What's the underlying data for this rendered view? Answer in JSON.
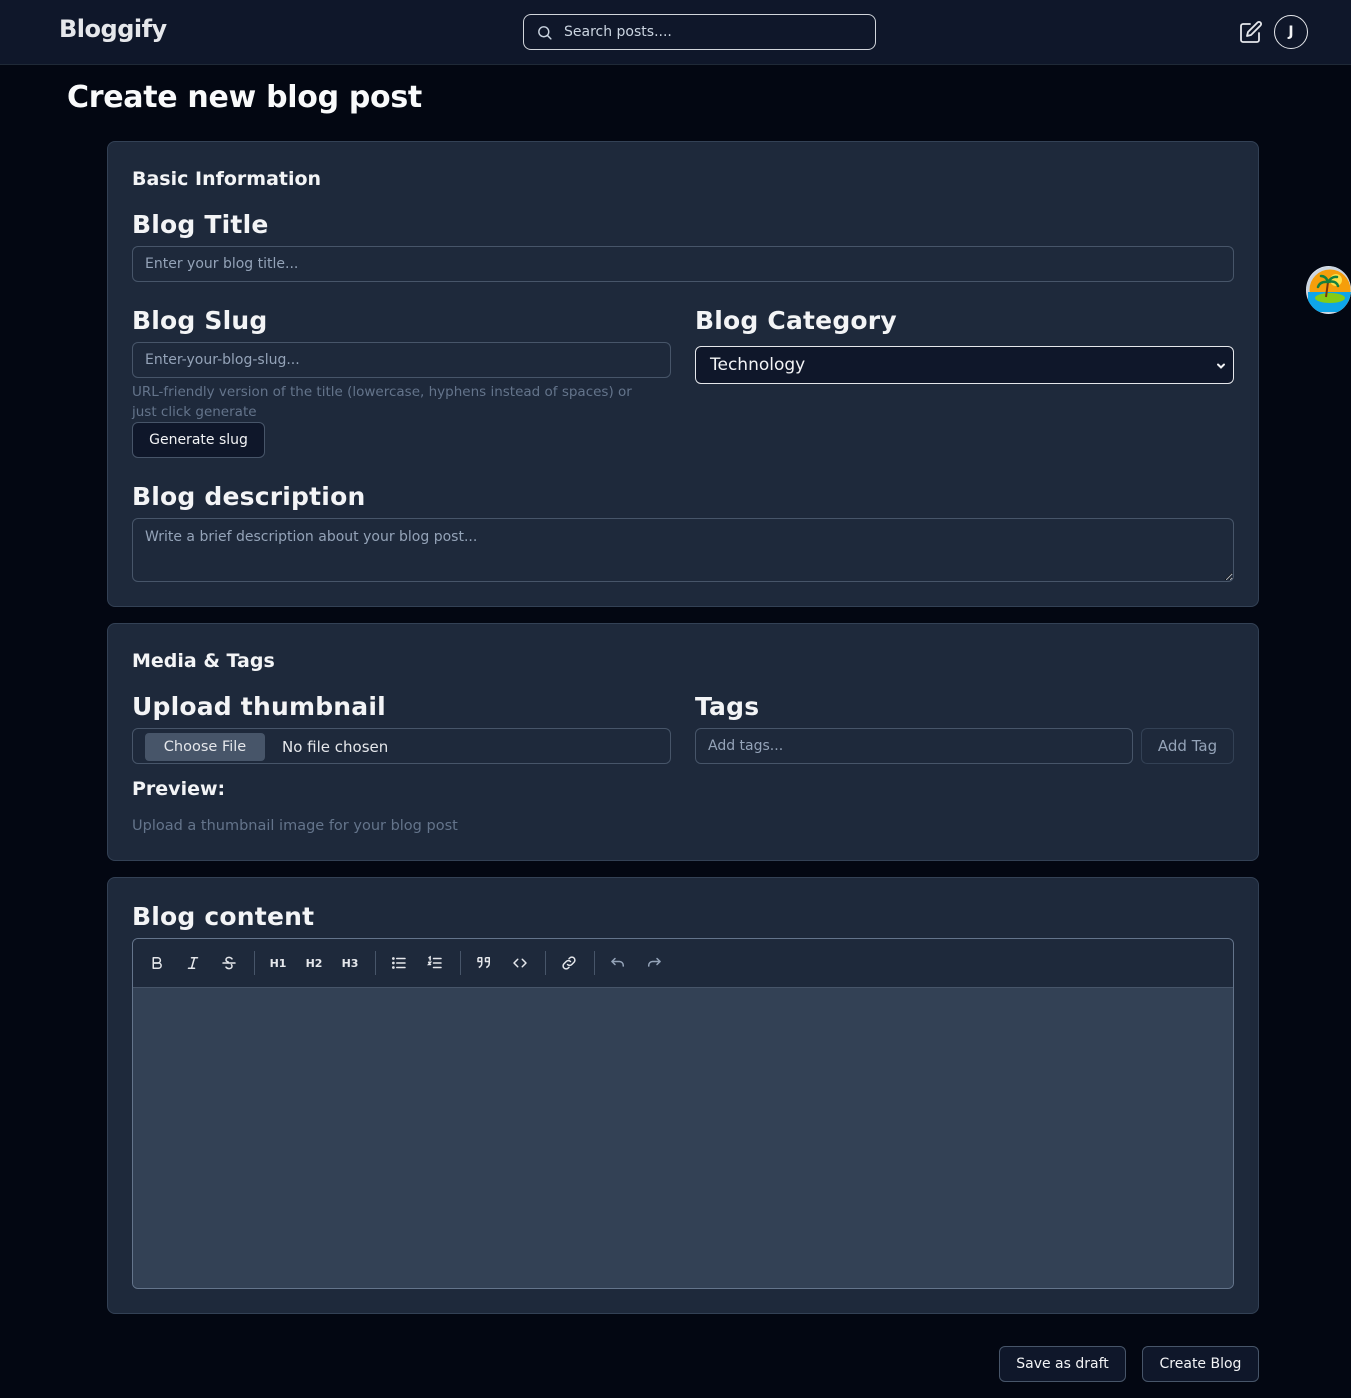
{
  "header": {
    "logo": "Bloggify",
    "search_placeholder": "Search posts....",
    "avatar_initial": "J"
  },
  "page": {
    "title": "Create new blog post"
  },
  "basic": {
    "heading": "Basic Information",
    "title_label": "Blog Title",
    "title_placeholder": "Enter your blog title...",
    "slug_label": "Blog Slug",
    "slug_placeholder": "Enter-your-blog-slug...",
    "slug_hint_line1": "URL-friendly version of the title (lowercase, hyphens instead of spaces) or",
    "slug_hint_line2": "just click generate",
    "generate_label": "Generate slug",
    "category_label": "Blog Category",
    "category_value": "Technology",
    "description_label": "Blog description",
    "description_placeholder": "Write a brief description about your blog post..."
  },
  "media": {
    "heading": "Media & Tags",
    "thumb_label": "Upload thumbnail",
    "choose_file": "Choose File",
    "file_status": "No file chosen",
    "preview_label": "Preview:",
    "preview_hint": "Upload a thumbnail image for your blog post",
    "tags_label": "Tags",
    "tags_placeholder": "Add tags...",
    "add_tag_label": "Add Tag"
  },
  "content": {
    "heading": "Blog content",
    "toolbar": {
      "h1": "H1",
      "h2": "H2",
      "h3": "H3"
    }
  },
  "footer": {
    "draft_label": "Save as draft",
    "create_label": "Create Blog"
  }
}
